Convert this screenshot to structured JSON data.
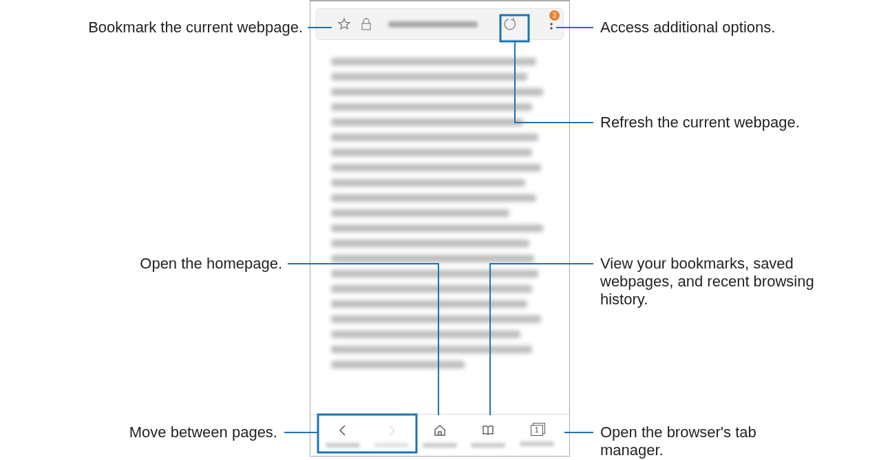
{
  "browser": {
    "menu_badge": "3",
    "bottom_bar": [
      {
        "kind": "back",
        "disabled": false
      },
      {
        "kind": "forward",
        "disabled": true
      },
      {
        "kind": "home"
      },
      {
        "kind": "bookmarks"
      },
      {
        "kind": "tabs",
        "count": "1"
      }
    ]
  },
  "callouts": [
    {
      "kind": "bookmark",
      "text": "Bookmark the current webpage."
    },
    {
      "kind": "options",
      "text": "Access additional options."
    },
    {
      "kind": "refresh",
      "text": "Refresh the current webpage."
    },
    {
      "kind": "home",
      "text": "Open the homepage."
    },
    {
      "kind": "bookmarks",
      "text": "View your bookmarks, saved webpages, and recent browsing history."
    },
    {
      "kind": "pages",
      "text": "Move between pages."
    },
    {
      "kind": "tabs",
      "text": "Open the browser's tab manager."
    }
  ]
}
